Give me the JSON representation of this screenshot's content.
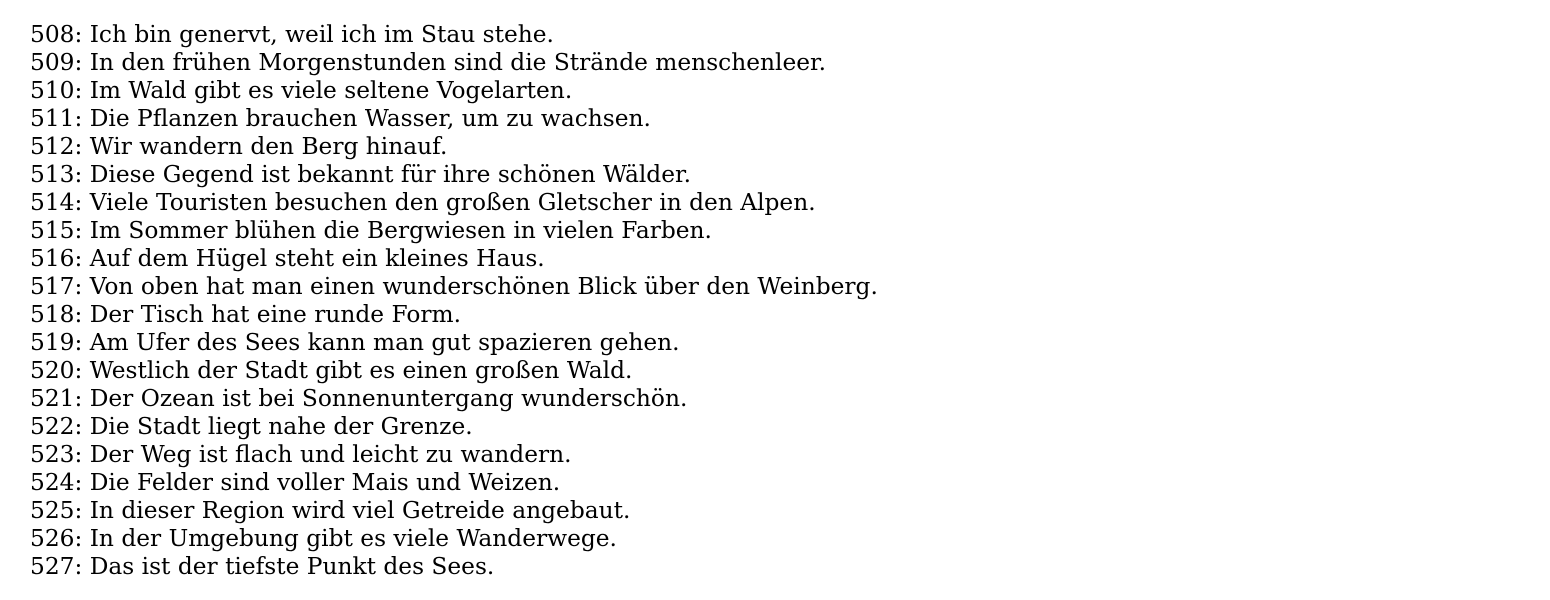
{
  "lines": [
    "508: Ich bin genervt, weil ich im Stau stehe.",
    "509: In den frühen Morgenstunden sind die Strände menschenleer.",
    "510: Im Wald gibt es viele seltene Vogelarten.",
    "511: Die Pflanzen brauchen Wasser, um zu wachsen.",
    "512: Wir wandern den Berg hinauf.",
    "513: Diese Gegend ist bekannt für ihre schönen Wälder.",
    "514: Viele Touristen besuchen den großen Gletscher in den Alpen.",
    "515: Im Sommer blühen die Bergwiesen in vielen Farben.",
    "516: Auf dem Hügel steht ein kleines Haus.",
    "517: Von oben hat man einen wunderschönen Blick über den Weinberg.",
    "518: Der Tisch hat eine runde Form.",
    "519: Am Ufer des Sees kann man gut spazieren gehen.",
    "520: Westlich der Stadt gibt es einen großen Wald.",
    "521: Der Ozean ist bei Sonnenuntergang wunderschön.",
    "522: Die Stadt liegt nahe der Grenze.",
    "523: Der Weg ist flach und leicht zu wandern.",
    "524: Die Felder sind voller Mais und Weizen.",
    "525: In dieser Region wird viel Getreide angebaut.",
    "526: In der Umgebung gibt es viele Wanderwege.",
    "527: Das ist der tiefste Punkt des Sees."
  ]
}
